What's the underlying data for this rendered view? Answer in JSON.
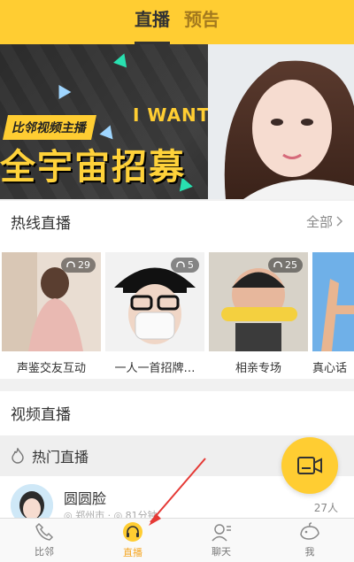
{
  "header": {
    "tabs": [
      {
        "label": "直播",
        "active": true
      },
      {
        "label": "预告",
        "active": false
      }
    ],
    "bg_color": "#ffcd32"
  },
  "banner": {
    "tag": "比邻视频主播",
    "headline": "I WANT U",
    "big_text": "全宇宙招募"
  },
  "hot": {
    "title": "热线直播",
    "more_label": "全部",
    "cards": [
      {
        "title": "声鉴交友互动",
        "count": "29"
      },
      {
        "title": "一人一首招牌…",
        "count": "5"
      },
      {
        "title": "相亲专场",
        "count": "25"
      },
      {
        "title": "真心话",
        "count": ""
      }
    ]
  },
  "video": {
    "title": "视频直播",
    "sub_title": "热门直播",
    "items": [
      {
        "name": "圆圆脸",
        "sub": "◎ 郑州市 · ◎ 81分钟",
        "count": "27人"
      }
    ]
  },
  "bottom_nav": {
    "items": [
      {
        "label": "比邻",
        "icon": "phone-icon",
        "active": false
      },
      {
        "label": "直播",
        "icon": "headset-icon",
        "active": true
      },
      {
        "label": "聊天",
        "icon": "chat-person-icon",
        "active": false
      },
      {
        "label": "我",
        "icon": "whale-icon",
        "active": false
      }
    ],
    "active_color": "#f5a623"
  }
}
